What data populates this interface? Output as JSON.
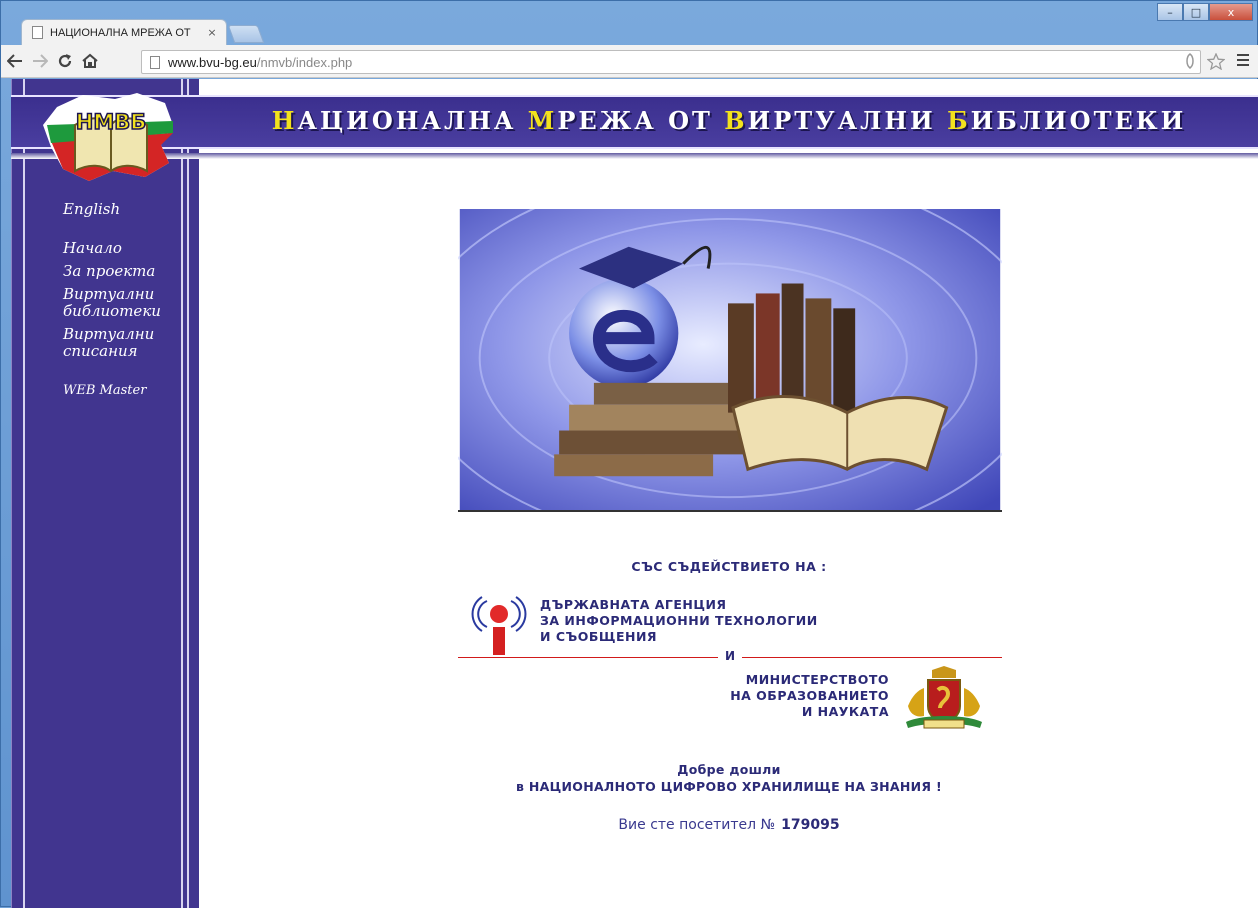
{
  "browser": {
    "tab_title": "НАЦИОНАЛНА МРЕЖА ОТ",
    "tab_close": "×",
    "url_host": "www.bvu-bg.eu",
    "url_path": "/nmvb/index.php",
    "window_buttons": [
      "–",
      "□",
      "x"
    ]
  },
  "site": {
    "logo_text": "НМВБ",
    "title_parts": [
      {
        "hl": "Н",
        "rest": "АЦИОНАЛНА"
      },
      {
        "hl": "М",
        "rest": "РЕЖА"
      },
      {
        "hl": "",
        "rest": "ОТ"
      },
      {
        "hl": "В",
        "rest": "ИРТУАЛНИ"
      },
      {
        "hl": "Б",
        "rest": "ИБЛИОТЕКИ"
      }
    ]
  },
  "menu": {
    "english": "English",
    "home": "Начало",
    "about": "За проекта",
    "libraries": "Виртуални библиотеки",
    "journals": "Виртуални списания",
    "webmaster": "WEB Master"
  },
  "main": {
    "support_heading": "СЪС СЪДЕЙСТВИЕТО НА :",
    "agency_lines": [
      "ДЪРЖАВНАТА АГЕНЦИЯ",
      "ЗА ИНФОРМАЦИОННИ ТЕХНОЛОГИИ",
      "И СЪОБЩЕНИЯ"
    ],
    "and": "И",
    "ministry_lines": [
      "МИНИСТЕРСТВОТО",
      "НА ОБРАЗОВАНИЕТО",
      "И НАУКАТА"
    ],
    "welcome_line1": "Добре дошли",
    "welcome_line2": "в НАЦИОНАЛНОТО ЦИФРОВО ХРАНИЛИЩЕ НА ЗНАНИЯ !",
    "visitor_label": "Вие сте посетител №",
    "visitor_count": "179095"
  },
  "colors": {
    "sidebar": "#41358f",
    "accent_yellow": "#f3e21d",
    "text_navy": "#2b2a77",
    "divider_red": "#d11a1a"
  }
}
